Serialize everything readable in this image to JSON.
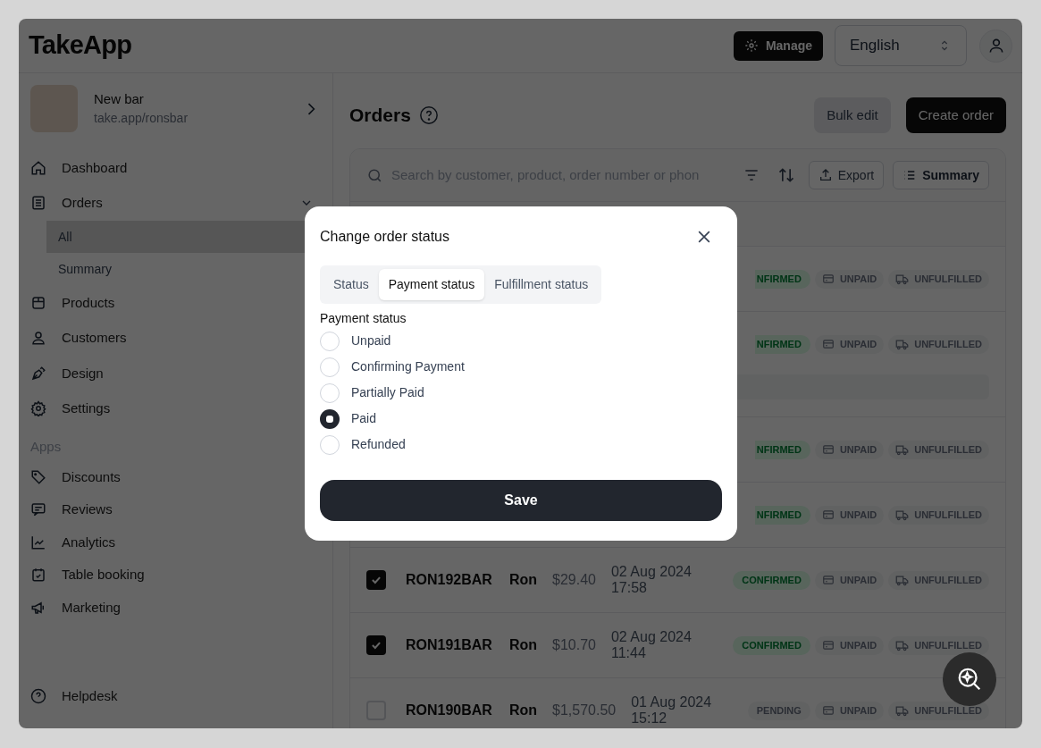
{
  "header": {
    "logo": "TakeApp",
    "manage_button": "Manage",
    "language": "English"
  },
  "sidebar": {
    "store": {
      "name": "New bar",
      "url": "take.app/ronsbar"
    },
    "items": [
      {
        "label": "Dashboard",
        "selected": false
      },
      {
        "label": "Orders",
        "selected": false,
        "expanded": true,
        "children": [
          {
            "label": "All",
            "selected": true
          },
          {
            "label": "Summary",
            "selected": false
          }
        ]
      },
      {
        "label": "Products",
        "selected": false
      },
      {
        "label": "Customers",
        "selected": false
      },
      {
        "label": "Design",
        "selected": false
      },
      {
        "label": "Settings",
        "selected": false
      }
    ],
    "apps_heading": "Apps",
    "apps": [
      {
        "label": "Discounts",
        "selected": false
      },
      {
        "label": "Reviews",
        "selected": false
      },
      {
        "label": "Analytics",
        "selected": false
      },
      {
        "label": "Table booking",
        "selected": false
      },
      {
        "label": "Marketing",
        "selected": false
      }
    ],
    "helpdesk": "Helpdesk"
  },
  "main": {
    "title": "Orders",
    "bulk_edit_button": "Bulk edit",
    "create_order_button": "Create order",
    "search": {
      "placeholder": "Search by customer, product, order number or phon"
    },
    "export_button": "Export",
    "summary_button": "Summary",
    "rows": [
      {
        "kind": "partial",
        "status": {
          "text": "NFIRMED",
          "kind": "confirmed"
        },
        "payment": "UNPAID",
        "fulfillment": "UNFULFILLED",
        "has_note": false
      },
      {
        "kind": "partial",
        "status": {
          "text": "NFIRMED",
          "kind": "confirmed"
        },
        "payment": "UNPAID",
        "fulfillment": "UNFULFILLED",
        "has_note": true
      },
      {
        "kind": "partial",
        "status": {
          "text": "NFIRMED",
          "kind": "confirmed"
        },
        "payment": "UNPAID",
        "fulfillment": "UNFULFILLED",
        "has_note": false
      },
      {
        "kind": "partial",
        "status": {
          "text": "NFIRMED",
          "kind": "confirmed"
        },
        "payment": "UNPAID",
        "fulfillment": "UNFULFILLED",
        "has_note": false
      },
      {
        "kind": "full",
        "selected": true,
        "order": "RON192BAR",
        "customer": "Ron",
        "total": "$29.40",
        "date": "02 Aug 2024",
        "time": "17:58",
        "status": {
          "text": "CONFIRMED",
          "kind": "confirmed"
        },
        "payment": "UNPAID",
        "fulfillment": "UNFULFILLED",
        "has_note": false
      },
      {
        "kind": "full",
        "selected": true,
        "order": "RON191BAR",
        "customer": "Ron",
        "total": "$10.70",
        "date": "02 Aug 2024",
        "time": "11:44",
        "status": {
          "text": "CONFIRMED",
          "kind": "confirmed"
        },
        "payment": "UNPAID",
        "fulfillment": "UNFULFILLED",
        "has_note": false
      },
      {
        "kind": "full",
        "selected": false,
        "order": "RON190BAR",
        "customer": "Ron",
        "total": "$1,570.50",
        "date": "01 Aug 2024",
        "time": "15:12",
        "status": {
          "text": "PENDING",
          "kind": "pending"
        },
        "payment": "UNPAID",
        "fulfillment": "UNFULFILLED",
        "has_note": false
      }
    ]
  },
  "dialog": {
    "title": "Change order status",
    "tabs": [
      {
        "label": "Status",
        "selected": false
      },
      {
        "label": "Payment status",
        "selected": true
      },
      {
        "label": "Fulfillment status",
        "selected": false
      }
    ],
    "field_label": "Payment status",
    "options": [
      {
        "label": "Unpaid",
        "selected": false
      },
      {
        "label": "Confirming Payment",
        "selected": false
      },
      {
        "label": "Partially Paid",
        "selected": false
      },
      {
        "label": "Paid",
        "selected": true
      },
      {
        "label": "Refunded",
        "selected": false
      }
    ],
    "save_button": "Save"
  }
}
